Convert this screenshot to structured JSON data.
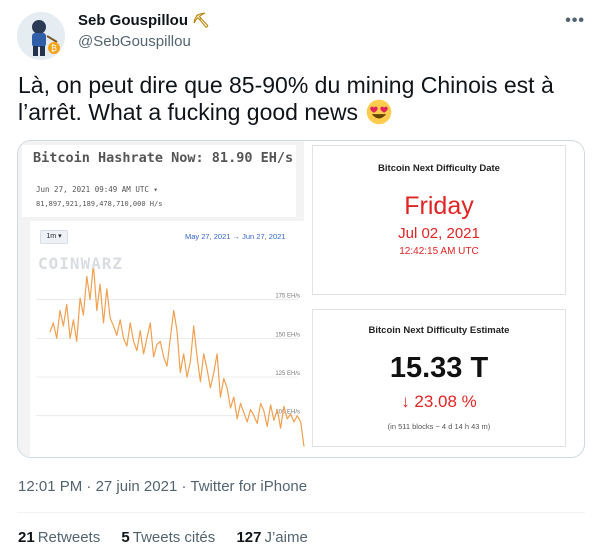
{
  "author": {
    "name": "Seb Gouspillou",
    "name_emoji": "⛏",
    "handle": "@SebGouspillou"
  },
  "more_label": "•••",
  "tweet": {
    "text": "Là, on peut dire que 85-90% du mining Chinois est à l’arrêt. What a fucking good news",
    "emoji": "heart-eyes-emoji"
  },
  "media": {
    "hashrate": {
      "title": "Bitcoin Hashrate Now: 81.90 EH/s",
      "date": "Jun 27, 2021 09:49 AM UTC",
      "date_marker": "▾",
      "hs_value": "81,897,921,189,478,710,000 H/s",
      "range_button": "1m ▾",
      "range_dates": "May 27, 2021  →  Jun 27, 2021",
      "watermark": "COINWARZ"
    },
    "difficulty_date": {
      "title": "Bitcoin Next Difficulty Date",
      "day": "Friday",
      "date": "Jul 02, 2021",
      "time": "12:42:15 AM UTC"
    },
    "difficulty_estimate": {
      "title": "Bitcoin Next Difficulty Estimate",
      "value": "15.33 T",
      "change": "↓ 23.08 %",
      "detail": "(in 511 blocks ~ 4 d 14 h 43 m)"
    }
  },
  "chart_data": {
    "type": "line",
    "title": "",
    "xlabel": "",
    "ylabel": "",
    "ylim": [
      72,
      200
    ],
    "y_ticks": [
      "175 EH/s",
      "150 EH/s",
      "125 EH/s",
      "100 EH/s"
    ],
    "y_tick_values": [
      175,
      150,
      125,
      100
    ],
    "color": "#f0a050",
    "series": [
      {
        "values": [
          154,
          160,
          150,
          168,
          158,
          172,
          150,
          162,
          148,
          176,
          165,
          190,
          175,
          198,
          168,
          185,
          160,
          182,
          163,
          158,
          152,
          162,
          150,
          145,
          160,
          148,
          142,
          155,
          140,
          150,
          160,
          138,
          146,
          148,
          138,
          132,
          150,
          168,
          155,
          128,
          140,
          125,
          135,
          158,
          138,
          122,
          140,
          130,
          118,
          128,
          140,
          112,
          124,
          118,
          105,
          112,
          98,
          108,
          102,
          96,
          104,
          100,
          95,
          108,
          103,
          93,
          107,
          97,
          104,
          92,
          106,
          98,
          101,
          96,
          100,
          96,
          80
        ]
      }
    ]
  },
  "meta": {
    "time": "12:01 PM",
    "sep1": " · ",
    "date": "27 juin 2021",
    "sep2": " · ",
    "source": "Twitter for iPhone"
  },
  "stats": [
    {
      "count": "21",
      "label": "Retweets"
    },
    {
      "count": "5",
      "label": "Tweets cités"
    },
    {
      "count": "127",
      "label": "J’aime"
    }
  ],
  "colors": {
    "text": "#0f1419",
    "secondary": "#536471",
    "red": "#e02424",
    "chart_line": "#f0a050",
    "link_blue": "#3366cc"
  }
}
